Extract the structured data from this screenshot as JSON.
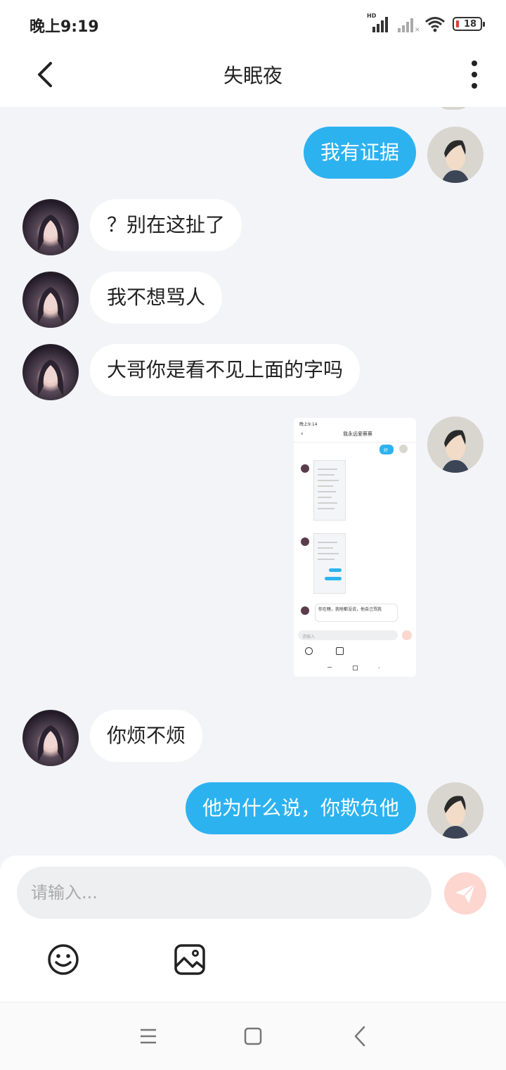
{
  "status_bar": {
    "time": "晚上9:19",
    "network_label": "HD",
    "battery_level": "18"
  },
  "header": {
    "title": "失眠夜"
  },
  "messages": [
    {
      "side": "out",
      "text": "我有证据"
    },
    {
      "side": "in",
      "text": "？别在这扯了"
    },
    {
      "side": "in",
      "text": "我不想骂人"
    },
    {
      "side": "in",
      "text": "大哥你是看不见上面的字吗"
    },
    {
      "side": "out",
      "type": "image",
      "thumbnail": {
        "time": "晚上9:14",
        "title": "我永远爱蔡蔡",
        "reply_bubble": "好",
        "last_message": "你在瞎，我啥都没说，他自己骂我",
        "input_placeholder": "请输入"
      }
    },
    {
      "side": "in",
      "text": "你烦不烦"
    },
    {
      "side": "out",
      "text": "他为什么说，你欺负他"
    }
  ],
  "composer": {
    "placeholder": "请输入..."
  },
  "colors": {
    "accent": "#2db2f0",
    "background": "#f3f4f8",
    "send_button": "#fdd6d0"
  },
  "icons": [
    "back-arrow-icon",
    "more-vertical-icon",
    "send-icon",
    "emoji-icon",
    "image-icon",
    "nav-menu-icon",
    "nav-home-icon",
    "nav-back-icon"
  ]
}
